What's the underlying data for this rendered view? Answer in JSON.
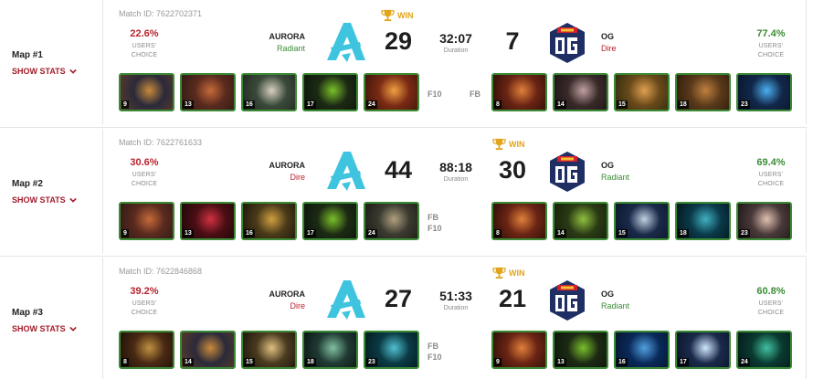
{
  "common": {
    "show_stats": "SHOW STATS",
    "users_choice": [
      "USERS'",
      "CHOICE"
    ],
    "duration_label": "Duration",
    "win_label": "WIN",
    "team_left": "AURORA",
    "team_right": "OG"
  },
  "colors": {
    "radiant": "#3d8c37",
    "dire": "#b8232e",
    "win": "#e0a51c",
    "accent": "#a31d2a"
  },
  "maps": [
    {
      "label": "Map #1",
      "match_id": "Match ID: 7622702371",
      "left_pct": "22.6%",
      "right_pct": "77.4%",
      "left_side": "Radiant",
      "right_side": "Dire",
      "left_score": "29",
      "right_score": "7",
      "duration": "32:07",
      "winner": "left",
      "left_flags": [
        "F10"
      ],
      "right_flags": [
        "FB"
      ],
      "left_heroes": [
        {
          "name": "hero-dark-knight",
          "level": "9",
          "colors": [
            "#2b2a3a",
            "#c98a3a",
            "#5a3a2a"
          ]
        },
        {
          "name": "hero-beast-rider",
          "level": "13",
          "colors": [
            "#5a2a1e",
            "#c56a3a",
            "#2c1a14"
          ]
        },
        {
          "name": "hero-white-cloak",
          "level": "16",
          "colors": [
            "#3a4a3a",
            "#d8d0c0",
            "#20281e"
          ]
        },
        {
          "name": "hero-green-shade",
          "level": "17",
          "colors": [
            "#1c2a14",
            "#7ac02a",
            "#0c140a"
          ]
        },
        {
          "name": "hero-flame-maiden",
          "level": "24",
          "colors": [
            "#7a2a14",
            "#f0a040",
            "#3a140a"
          ]
        }
      ],
      "right_heroes": [
        {
          "name": "hero-red-brute",
          "level": "8",
          "colors": [
            "#6a2414",
            "#e0803a",
            "#2a0e08"
          ]
        },
        {
          "name": "hero-pale-warrior",
          "level": "14",
          "colors": [
            "#3a2a2a",
            "#c0a0a0",
            "#1a1212"
          ]
        },
        {
          "name": "hero-windrunner",
          "level": "15",
          "colors": [
            "#6a4a1a",
            "#e0a050",
            "#2a2a10"
          ]
        },
        {
          "name": "hero-brown-beast",
          "level": "18",
          "colors": [
            "#5a3a1a",
            "#c08040",
            "#2a1a0a"
          ]
        },
        {
          "name": "hero-storm-spirit",
          "level": "23",
          "colors": [
            "#12284a",
            "#4ab0f0",
            "#081428"
          ]
        }
      ]
    },
    {
      "label": "Map #2",
      "match_id": "Match ID: 7622761633",
      "left_pct": "30.6%",
      "right_pct": "69.4%",
      "left_side": "Dire",
      "right_side": "Radiant",
      "left_score": "44",
      "right_score": "30",
      "duration": "88:18",
      "winner": "right",
      "left_flags": [
        "FB",
        "F10"
      ],
      "right_flags": [],
      "left_heroes": [
        {
          "name": "hero-beast-rider",
          "level": "9",
          "colors": [
            "#5a2a1e",
            "#c56a3a",
            "#2c1a14"
          ]
        },
        {
          "name": "hero-crimson-mage",
          "level": "13",
          "colors": [
            "#4a0e14",
            "#d03040",
            "#1a0608"
          ]
        },
        {
          "name": "hero-goblin-tinker",
          "level": "16",
          "colors": [
            "#4a3a1a",
            "#d0a040",
            "#1a1408"
          ]
        },
        {
          "name": "hero-green-shade",
          "level": "17",
          "colors": [
            "#1c2a14",
            "#7ac02a",
            "#0c140a"
          ]
        },
        {
          "name": "hero-bearded-fighter",
          "level": "24",
          "colors": [
            "#3a3a30",
            "#b0a080",
            "#1a1a14"
          ]
        }
      ],
      "right_heroes": [
        {
          "name": "hero-red-brute",
          "level": "8",
          "colors": [
            "#6a2414",
            "#e0803a",
            "#2a0e08"
          ]
        },
        {
          "name": "hero-green-ogre",
          "level": "14",
          "colors": [
            "#2a3a14",
            "#90c040",
            "#141e0a"
          ]
        },
        {
          "name": "hero-dark-lady",
          "level": "15",
          "colors": [
            "#1a2a4a",
            "#c0d0e0",
            "#0a1428"
          ]
        },
        {
          "name": "hero-tidal-wave",
          "level": "18",
          "colors": [
            "#0a3a4a",
            "#40b0c0",
            "#041418"
          ]
        },
        {
          "name": "hero-white-sage",
          "level": "23",
          "colors": [
            "#4a3a3a",
            "#e0c0b0",
            "#1a1414"
          ]
        }
      ]
    },
    {
      "label": "Map #3",
      "match_id": "Match ID: 7622846868",
      "left_pct": "39.2%",
      "right_pct": "60.8%",
      "left_side": "Dire",
      "right_side": "Radiant",
      "left_score": "27",
      "right_score": "21",
      "duration": "51:33",
      "winner": "right",
      "left_flags": [
        "FB",
        "F10"
      ],
      "right_flags": [],
      "left_heroes": [
        {
          "name": "hero-armored-knight",
          "level": "8",
          "colors": [
            "#4a2a14",
            "#c09040",
            "#1a0e06"
          ]
        },
        {
          "name": "hero-dark-knight",
          "level": "14",
          "colors": [
            "#2b2a3a",
            "#c98a3a",
            "#5a3a2a"
          ]
        },
        {
          "name": "hero-hooded-monk",
          "level": "15",
          "colors": [
            "#4a3a20",
            "#e0c080",
            "#1a140a"
          ]
        },
        {
          "name": "hero-undead-lord",
          "level": "18",
          "colors": [
            "#203a34",
            "#80c0a0",
            "#0a1410"
          ]
        },
        {
          "name": "hero-frost-serpent",
          "level": "23",
          "colors": [
            "#0a3a44",
            "#50c0d0",
            "#04181c"
          ]
        }
      ],
      "right_heroes": [
        {
          "name": "hero-red-brute",
          "level": "9",
          "colors": [
            "#6a2414",
            "#e0803a",
            "#2a0e08"
          ]
        },
        {
          "name": "hero-green-shade",
          "level": "13",
          "colors": [
            "#1c2a14",
            "#7ac02a",
            "#0c140a"
          ]
        },
        {
          "name": "hero-sky-dragon",
          "level": "16",
          "colors": [
            "#0a2a5a",
            "#50a0e0",
            "#04142a"
          ]
        },
        {
          "name": "hero-light-spirit",
          "level": "17",
          "colors": [
            "#1a2a4a",
            "#d0e8ff",
            "#0a1428"
          ]
        },
        {
          "name": "hero-teal-assassin",
          "level": "24",
          "colors": [
            "#0a3a30",
            "#40c0a0",
            "#04181a"
          ]
        }
      ]
    }
  ]
}
